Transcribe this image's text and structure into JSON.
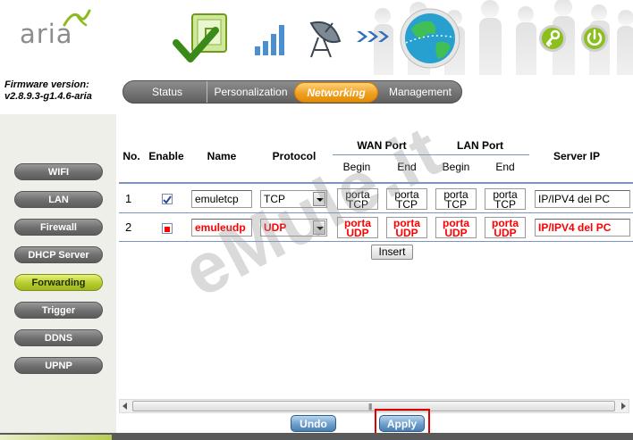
{
  "brand": {
    "logo_text": "aria"
  },
  "firmware": {
    "label": "Firmware version:",
    "value": "v2.8.9.3-g1.4.6-aria"
  },
  "tabs": [
    {
      "label": "Status",
      "active": false
    },
    {
      "label": "Personalization",
      "active": false
    },
    {
      "label": "Networking",
      "active": true
    },
    {
      "label": "Management",
      "active": false
    }
  ],
  "sidebar": {
    "items": [
      {
        "label": "WIFI",
        "active": false
      },
      {
        "label": "LAN",
        "active": false
      },
      {
        "label": "Firewall",
        "active": false
      },
      {
        "label": "DHCP Server",
        "active": false
      },
      {
        "label": "Forwarding",
        "active": true
      },
      {
        "label": "Trigger",
        "active": false
      },
      {
        "label": "DDNS",
        "active": false
      },
      {
        "label": "UPNP",
        "active": false
      }
    ]
  },
  "table": {
    "headers": {
      "no": "No.",
      "enable": "Enable",
      "name": "Name",
      "protocol": "Protocol",
      "wan_port": "WAN Port",
      "lan_port": "LAN Port",
      "server_ip": "Server IP",
      "begin": "Begin",
      "end": "End"
    },
    "rows": [
      {
        "no": "1",
        "enabled": true,
        "name": "emuletcp",
        "protocol": "TCP",
        "wan_begin": [
          "porta",
          "TCP"
        ],
        "wan_end": [
          "porta",
          "TCP"
        ],
        "lan_begin": [
          "porta",
          "TCP"
        ],
        "lan_end": [
          "porta",
          "TCP"
        ],
        "server_ip": "IP/IPV4 del PC",
        "highlight": false
      },
      {
        "no": "2",
        "enabled": true,
        "name": "emuleudp",
        "protocol": "UDP",
        "wan_begin": [
          "porta",
          "UDP"
        ],
        "wan_end": [
          "porta",
          "UDP"
        ],
        "lan_begin": [
          "porta",
          "UDP"
        ],
        "lan_end": [
          "porta",
          "UDP"
        ],
        "server_ip": "IP/IPV4 del PC",
        "highlight": true
      }
    ],
    "insert_label": "Insert"
  },
  "actions": {
    "undo_label": "Undo",
    "apply_label": "Apply"
  },
  "watermark": {
    "text": "eMule.it"
  },
  "colors": {
    "accent_tab": "#f0a020",
    "active_sidebar": "#b6cc2c",
    "highlight_red": "#ff0000",
    "button_blue": "#6e9fcc"
  }
}
